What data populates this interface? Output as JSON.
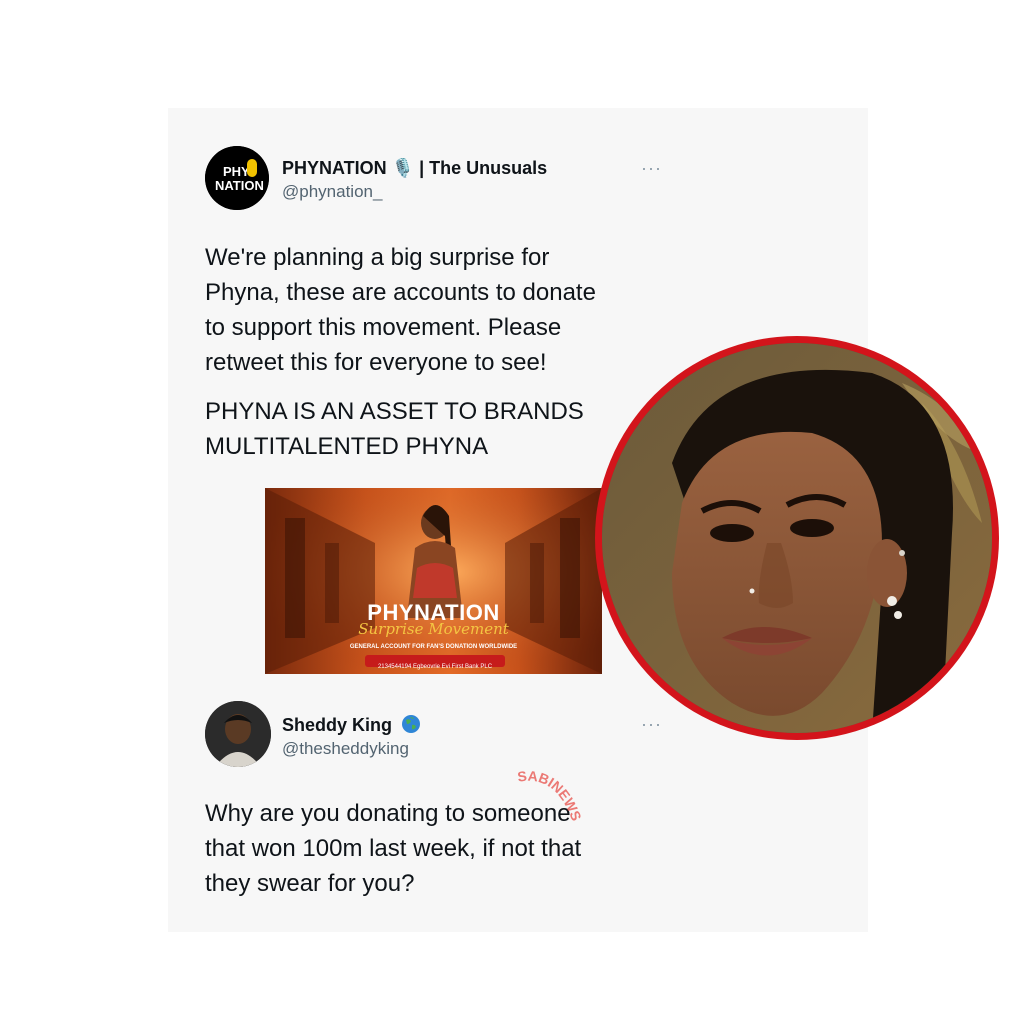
{
  "tweet1": {
    "display_name": "PHYNATION 🎙️ | The Unusuals",
    "handle": "@phynation_",
    "avatar_text": [
      "PHY",
      "NATION"
    ],
    "more_label": "···",
    "lines": [
      "We're planning a big surprise for",
      "Phyna, these are accounts to  donate",
      "to support this movement. Please",
      "retweet this for everyone to see!"
    ],
    "lines2": [
      "PHYNA IS AN ASSET TO BRANDS",
      "MULTITALENTED PHYNA"
    ],
    "media": {
      "title": "PHYNATION",
      "script": "Surprise Movement",
      "subtitle": "GENERAL ACCOUNT FOR FAN'S DONATION WORLDWIDE",
      "account": "2134544194 Egbeovrie Evi First Bank PLC"
    }
  },
  "tweet2": {
    "display_name": "Sheddy King",
    "verified_icon": "globe-icon",
    "handle": "@thesheddyking",
    "more_label": "···",
    "lines": [
      "Why are you donating to someone",
      "that won 100m last week, if not that",
      "they swear for you?"
    ]
  },
  "watermark": "SABINEWS",
  "colors": {
    "ring": "#d3141b",
    "media_orange": "#e86e28",
    "handle": "#536471"
  }
}
